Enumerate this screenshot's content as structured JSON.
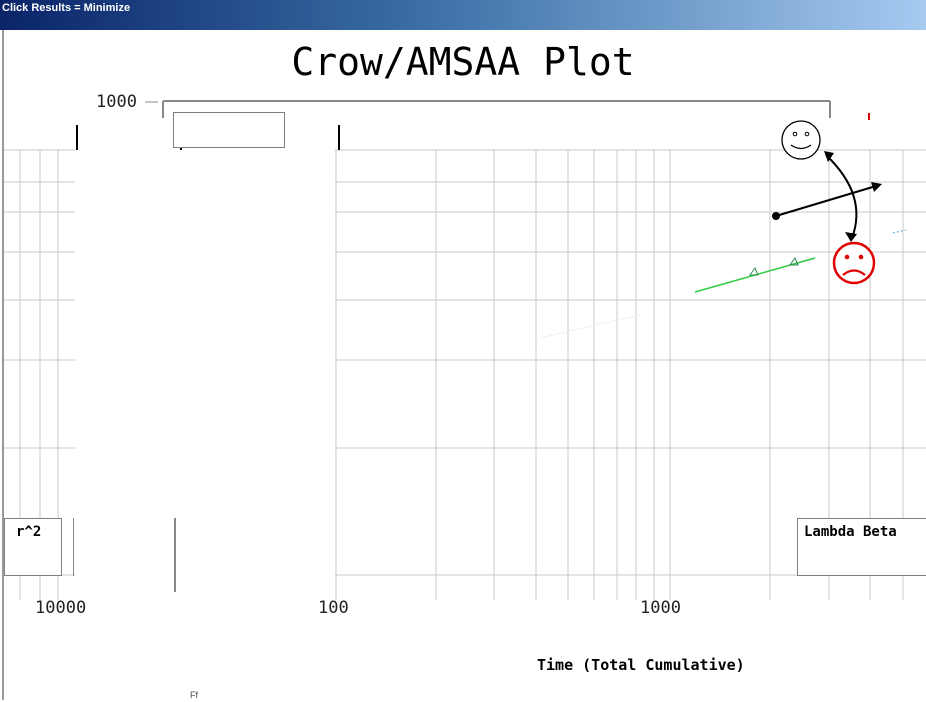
{
  "window": {
    "titlebar_text": "Click Results = Minimize"
  },
  "plot": {
    "title": "Crow/AMSAA Plot",
    "xlabel": "Time (Total Cumulative)",
    "ytick_top": "1000",
    "xticks": [
      "10000",
      "100",
      "1000"
    ],
    "small_text": "Ff"
  },
  "legend_boxes": {
    "left_label": "r^2",
    "right_label": "Lambda Beta"
  },
  "annotations": {
    "happy_face": "happy-face-icon",
    "sad_face": "sad-face-icon",
    "sad_face_color": "#e00000",
    "trend_line_color": "#2ecc40"
  }
}
